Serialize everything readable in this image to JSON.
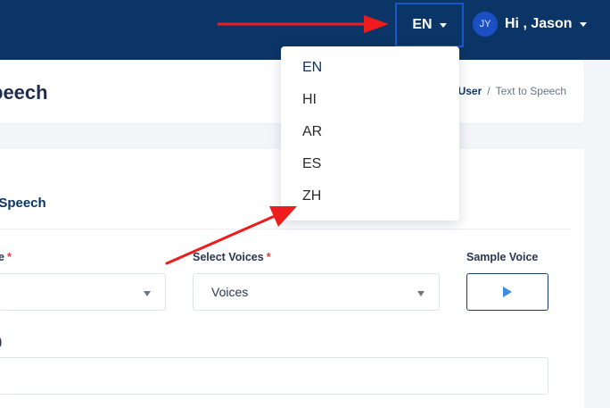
{
  "topbar": {
    "language_selected": "EN",
    "user": {
      "initials": "JY",
      "greeting": "Hi , Jason"
    }
  },
  "header": {
    "title": "peech",
    "breadcrumb": [
      "User",
      "/",
      "Text to Speech"
    ]
  },
  "form": {
    "section_title": "o Speech",
    "labels": {
      "first": "e",
      "voices": "Select Voices",
      "sample": "Sample Voice",
      "text": ")"
    },
    "voices_value": "Voices",
    "first_value": "",
    "text_value": ""
  },
  "language_menu": {
    "items": [
      "EN",
      "HI",
      "AR",
      "ES",
      "ZH"
    ]
  },
  "colors": {
    "navbar": "#0a3566",
    "accent": "#1657c9",
    "required": "#e03a3a",
    "annotation": "#ee1c1c"
  },
  "icons": {
    "caret": "chevron-down-icon",
    "play": "play-icon"
  }
}
